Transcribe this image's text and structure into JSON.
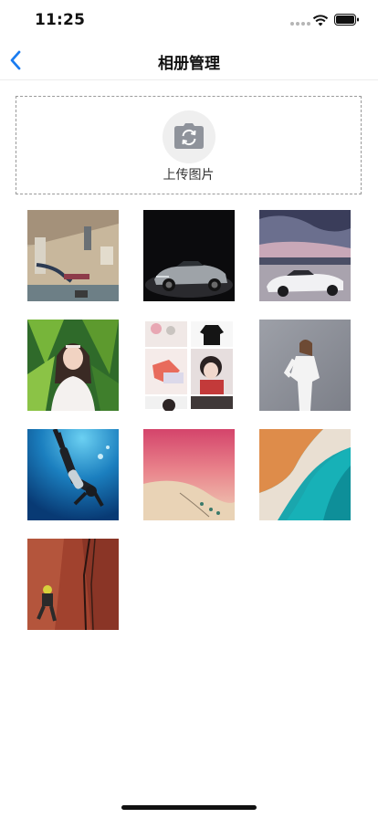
{
  "status_bar": {
    "time": "11:25"
  },
  "nav": {
    "title": "相册管理"
  },
  "upload": {
    "label": "上传图片"
  },
  "photos": [
    "room-photo",
    "sports-car-dark",
    "sports-car-sunset",
    "girl-in-garden",
    "fashion-collage",
    "woman-white-outfit",
    "scuba-diver",
    "aerial-pink-beach",
    "aerial-turquoise-sea",
    "rock-climber"
  ]
}
